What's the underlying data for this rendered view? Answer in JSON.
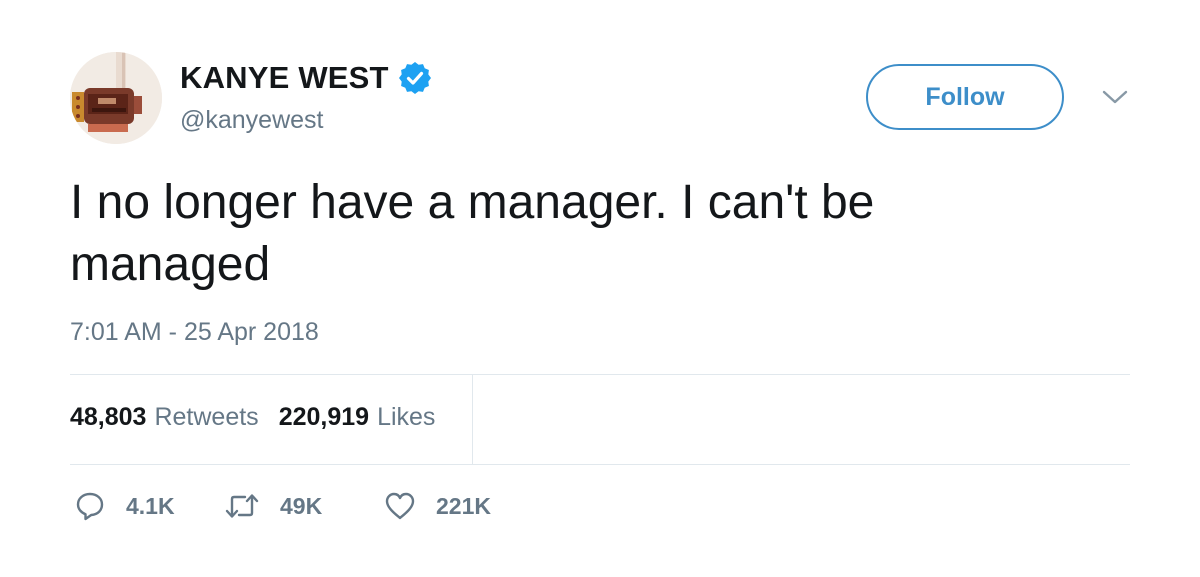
{
  "author": {
    "display_name": "KANYE WEST",
    "handle": "@kanyewest",
    "verified": true,
    "avatar_icon": "avatar-image"
  },
  "follow_button": {
    "label": "Follow"
  },
  "menu": {
    "icon": "chevron-down-icon"
  },
  "tweet": {
    "text": "I no longer have a manager. I can't be managed",
    "timestamp": "7:01 AM - 25 Apr 2018"
  },
  "stats": {
    "retweets_count": "48,803",
    "retweets_label": "Retweets",
    "likes_count": "220,919",
    "likes_label": "Likes"
  },
  "actions": {
    "reply_count": "4.1K",
    "retweet_count": "49K",
    "like_count": "221K",
    "reply_icon": "reply-icon",
    "retweet_icon": "retweet-icon",
    "like_icon": "heart-icon"
  },
  "colors": {
    "verified_badge": "#1da1f2",
    "follow_accent": "#3d8ec9",
    "secondary_text": "#657786",
    "primary_text": "#14171a",
    "divider": "#e1e8ed"
  }
}
